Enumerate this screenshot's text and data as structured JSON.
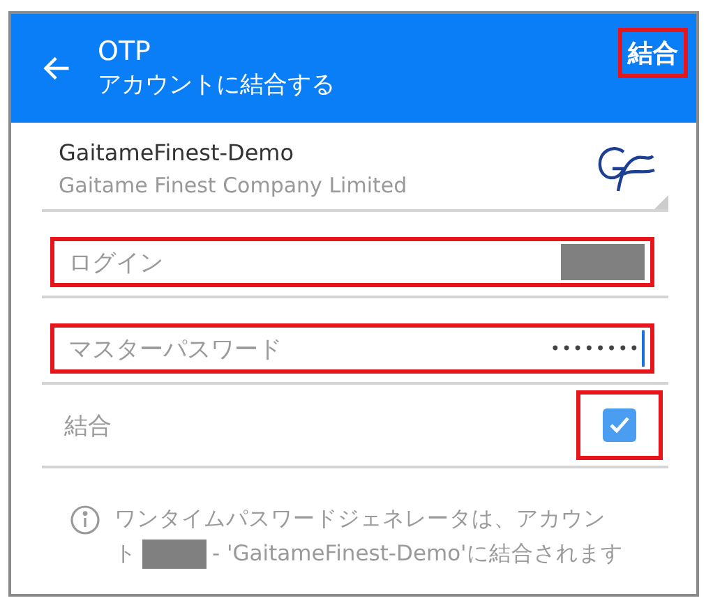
{
  "header": {
    "title": "OTP",
    "subtitle": "アカウントに結合する",
    "action": {
      "label": "結合",
      "highlighted": true
    }
  },
  "account": {
    "name": "GaitameFinest-Demo",
    "company": "Gaitame Finest Company Limited"
  },
  "fields": [
    {
      "kind": "text",
      "placeholder": "ログイン",
      "value_redacted": true,
      "highlighted": true
    },
    {
      "kind": "password",
      "placeholder": "マスターパスワード",
      "value": "••••••••",
      "focused": true,
      "highlighted": true
    }
  ],
  "link_option": {
    "label": "結合",
    "checked": true,
    "highlighted": true
  },
  "info": {
    "line_1": "ワンタイムパスワードジェネレータは、アカウン",
    "line_2_start": "ト",
    "redacted": true,
    "line_2_end": "- 'GaitameFinest-Demo'に結合されます"
  }
}
